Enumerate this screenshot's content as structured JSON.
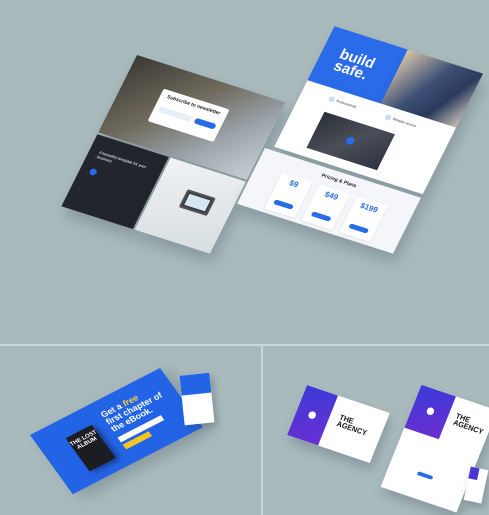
{
  "colors": {
    "background": "#a9babd",
    "accent_blue": "#2a6be9",
    "ebook_blue": "#2364e6",
    "agency_purple": "#4a36d8",
    "cta_yellow": "#f3c623"
  },
  "newsletter": {
    "title": "Subscribe to newsletter"
  },
  "dark_panel": {
    "text": "A beautiful template for your business"
  },
  "build": {
    "headline": "build safe.",
    "features": [
      "Professionals",
      "Reliable service"
    ],
    "play_icon": "play-icon"
  },
  "pricing": {
    "title": "Pricing & Plans",
    "plans": [
      {
        "price": "$9"
      },
      {
        "price": "$49"
      },
      {
        "price": "$199"
      }
    ]
  },
  "ebook": {
    "headline_a": "Get a ",
    "headline_em": "free",
    "headline_b": "first chapter of the eBook.",
    "book_title": "THE LOST ALBUM"
  },
  "agency": {
    "title": "THE AGENCY"
  }
}
